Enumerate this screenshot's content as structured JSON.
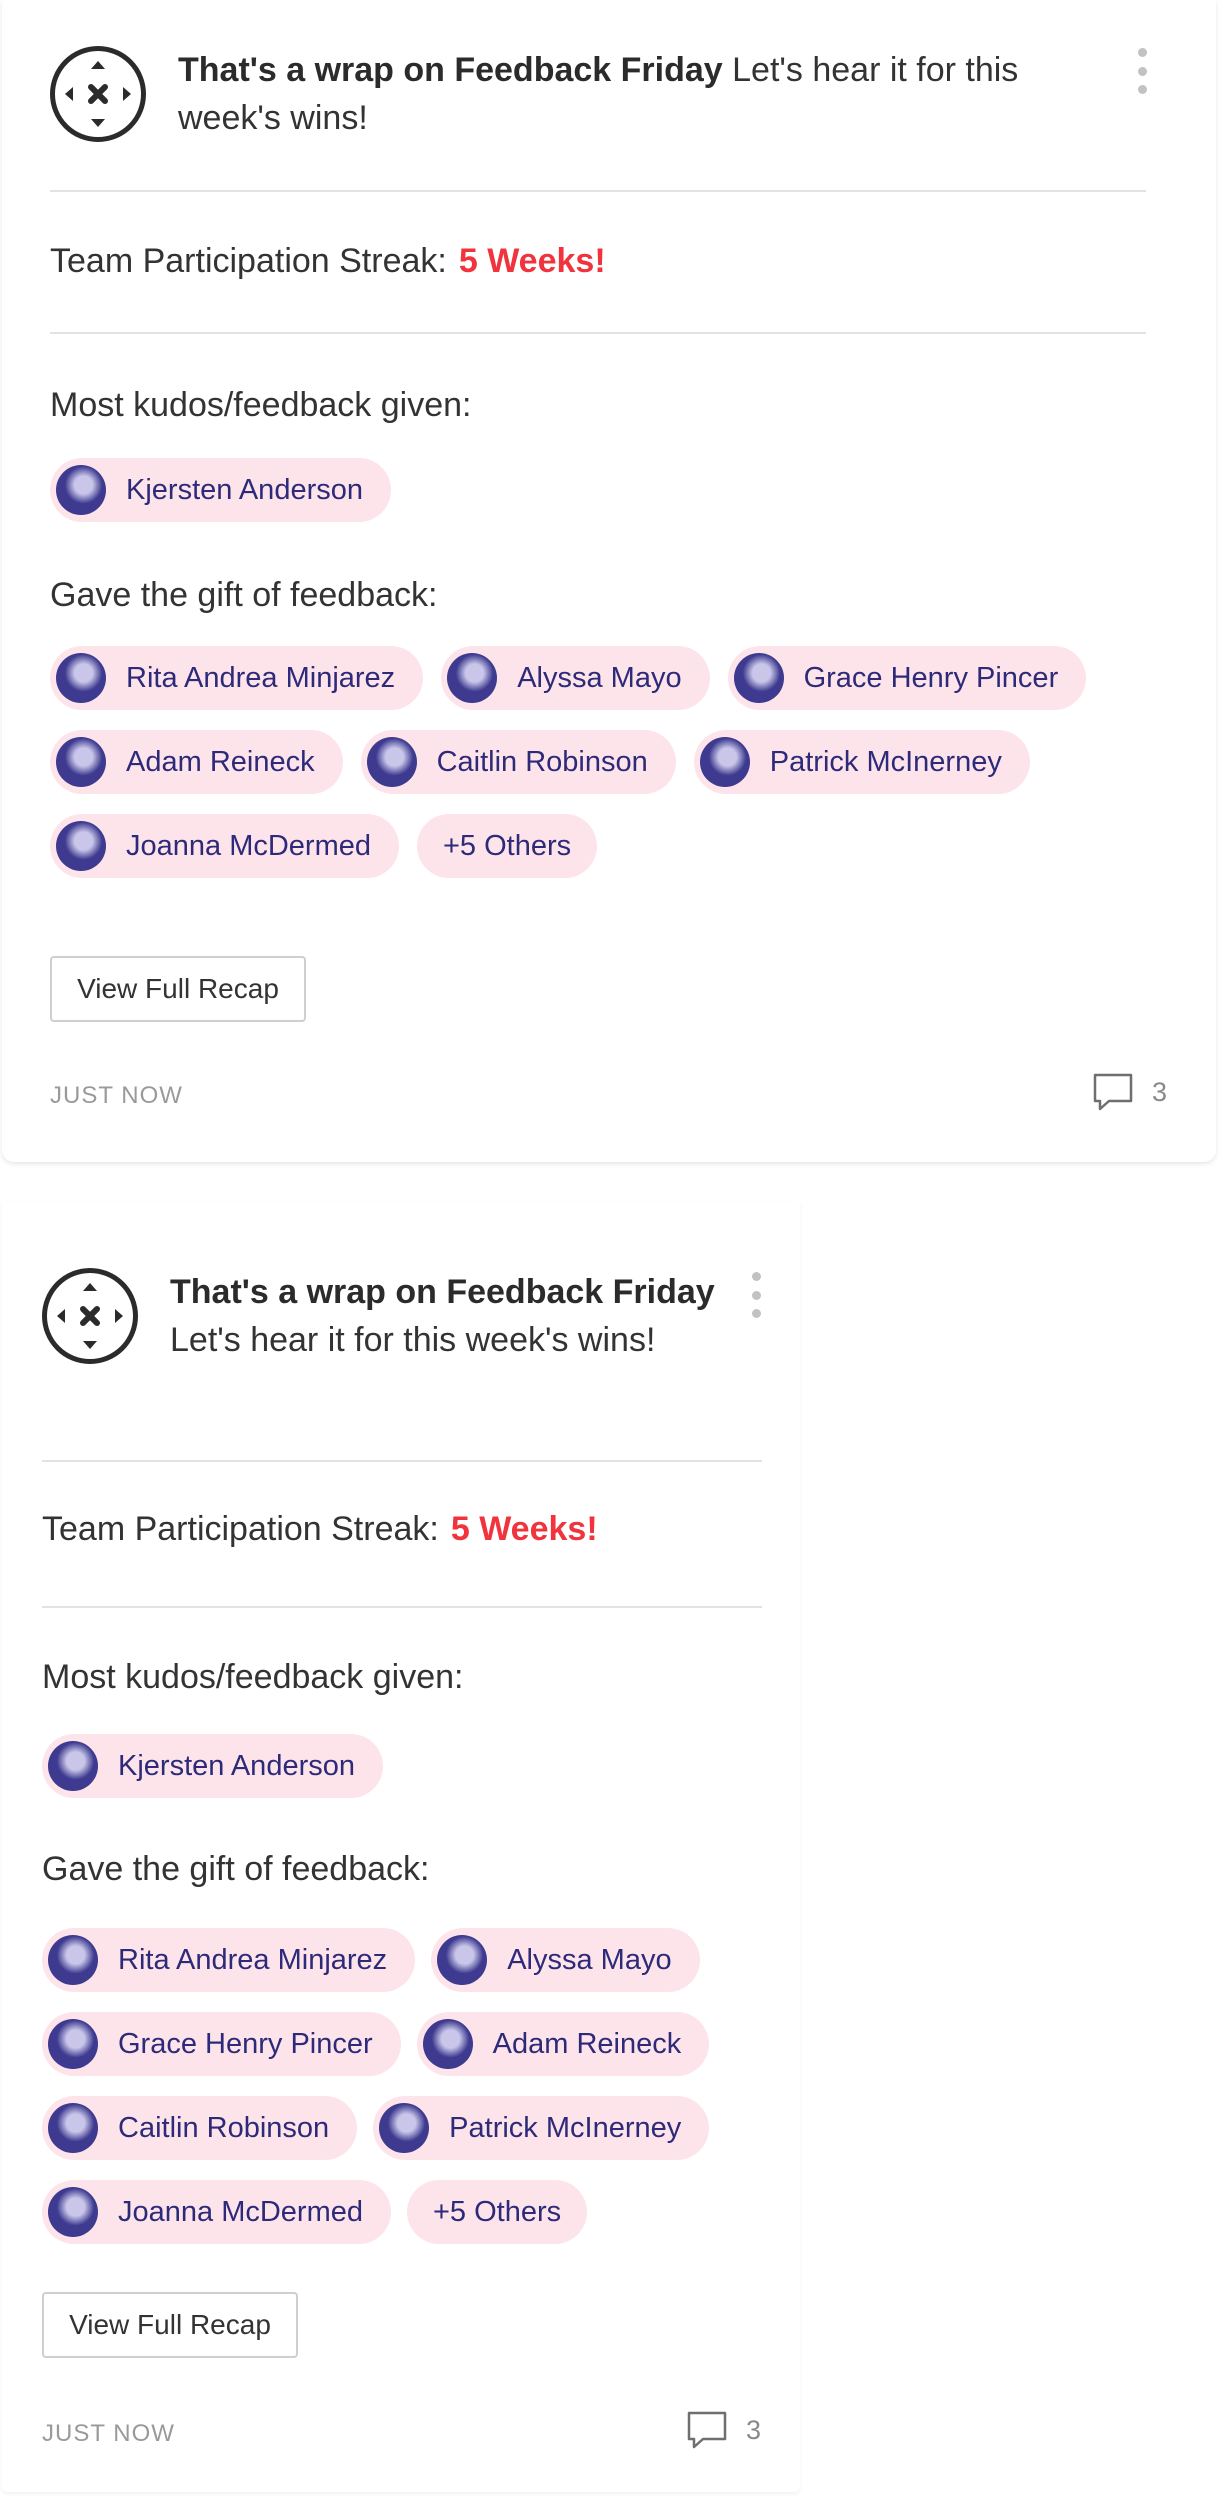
{
  "posts": [
    {
      "headline_bold": "That's a wrap on Feedback Friday",
      "headline_rest": " Let's hear it for this week's wins!",
      "streak_label": "Team Participation Streak:",
      "streak_value": "5 Weeks!",
      "most_label": "Most kudos/feedback given:",
      "most_people": [
        {
          "name": "Kjersten Anderson",
          "avatar": "avatar-icon"
        }
      ],
      "gave_label": "Gave the gift of feedback:",
      "gave_people": [
        {
          "name": "Rita Andrea Minjarez",
          "avatar": "avatar-icon"
        },
        {
          "name": "Alyssa Mayo",
          "avatar": "avatar-icon"
        },
        {
          "name": "Grace Henry Pincer",
          "avatar": "avatar-icon"
        },
        {
          "name": "Adam Reineck",
          "avatar": "avatar-icon"
        },
        {
          "name": "Caitlin Robinson",
          "avatar": "avatar-icon"
        },
        {
          "name": "Patrick McInerney",
          "avatar": "avatar-icon"
        },
        {
          "name": "Joanna McDermed",
          "avatar": "avatar-icon"
        }
      ],
      "others_label": "+5 Others",
      "button_label": "View Full Recap",
      "timestamp": "JUST NOW",
      "comment_count": "3"
    },
    {
      "headline_bold": "That's a wrap on Feedback Friday",
      "headline_rest": " Let's hear it for this week's wins!",
      "streak_label": "Team Participation Streak:",
      "streak_value": "5 Weeks!",
      "most_label": "Most kudos/feedback given:",
      "most_people": [
        {
          "name": "Kjersten Anderson",
          "avatar": "avatar-icon"
        }
      ],
      "gave_label": "Gave the gift of feedback:",
      "gave_people": [
        {
          "name": "Rita Andrea Minjarez",
          "avatar": "avatar-icon"
        },
        {
          "name": "Alyssa Mayo",
          "avatar": "avatar-icon"
        },
        {
          "name": "Grace Henry Pincer",
          "avatar": "avatar-icon"
        },
        {
          "name": "Adam Reineck",
          "avatar": "avatar-icon"
        },
        {
          "name": "Caitlin Robinson",
          "avatar": "avatar-icon"
        },
        {
          "name": "Patrick McInerney",
          "avatar": "avatar-icon"
        },
        {
          "name": "Joanna McDermed",
          "avatar": "avatar-icon"
        }
      ],
      "others_label": "+5 Others",
      "button_label": "View Full Recap",
      "timestamp": "JUST NOW",
      "comment_count": "3"
    }
  ],
  "colors": {
    "streak_value": "#f0333c",
    "pill_background": "#fde4ea",
    "pill_text": "#2e2a7a",
    "avatar": "#3d3a8f"
  },
  "icons": {
    "logo": "compass-arrows-icon",
    "menu": "kebab-menu-icon",
    "comments": "speech-bubble-icon"
  }
}
